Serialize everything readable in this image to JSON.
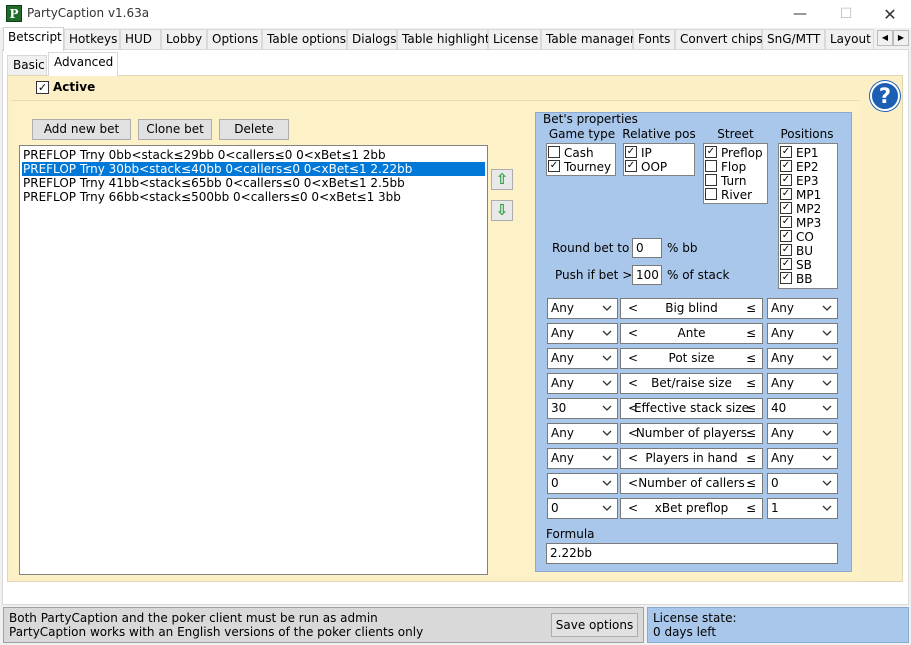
{
  "window": {
    "title": "PartyCaption v1.63a",
    "icon_letter": "P",
    "minimize_glyph": "—",
    "maximize_glyph": "☐",
    "close_glyph": "✕"
  },
  "tabs": [
    "Betscript",
    "Hotkeys",
    "HUD",
    "Lobby",
    "Options",
    "Table options",
    "Dialogs",
    "Table highlight",
    "License",
    "Table manager",
    "Fonts",
    "Convert chips",
    "SnG/MTT",
    "Layout"
  ],
  "tab_scroll": {
    "left": "◀",
    "right": "▶"
  },
  "subtabs": [
    "Basic",
    "Advanced"
  ],
  "active_label": "Active",
  "active_checked": "✓",
  "buttons": {
    "add": "Add new bet",
    "clone": "Clone bet",
    "delete": "Delete",
    "move_up": "⇧",
    "move_down": "⇩",
    "help": "?"
  },
  "bets": [
    "PREFLOP Trny 0bb<stack≤29bb 0<callers≤0 0<xBet≤1 2bb",
    "PREFLOP Trny 30bb<stack≤40bb 0<callers≤0 0<xBet≤1 2.22bb",
    "PREFLOP Trny 41bb<stack≤65bb 0<callers≤0 0<xBet≤1 2.5bb",
    "PREFLOP Trny 66bb<stack≤500bb 0<callers≤0 0<xBet≤1 3bb"
  ],
  "props": {
    "title": "Bet's properties",
    "game_type": {
      "title": "Game type",
      "items": [
        {
          "label": "Cash",
          "checked": ""
        },
        {
          "label": "Tourney",
          "checked": "✓"
        }
      ]
    },
    "relative_pos": {
      "title": "Relative pos",
      "items": [
        {
          "label": "IP",
          "checked": "✓"
        },
        {
          "label": "OOP",
          "checked": "✓"
        }
      ]
    },
    "street": {
      "title": "Street",
      "items": [
        {
          "label": "Preflop",
          "checked": "✓"
        },
        {
          "label": "Flop",
          "checked": ""
        },
        {
          "label": "Turn",
          "checked": ""
        },
        {
          "label": "River",
          "checked": ""
        }
      ]
    },
    "positions": {
      "title": "Positions",
      "items": [
        {
          "label": "EP1",
          "checked": "✓"
        },
        {
          "label": "EP2",
          "checked": "✓"
        },
        {
          "label": "EP3",
          "checked": "✓"
        },
        {
          "label": "MP1",
          "checked": "✓"
        },
        {
          "label": "MP2",
          "checked": "✓"
        },
        {
          "label": "MP3",
          "checked": "✓"
        },
        {
          "label": "CO",
          "checked": "✓"
        },
        {
          "label": "BU",
          "checked": "✓"
        },
        {
          "label": "SB",
          "checked": "✓"
        },
        {
          "label": "BB",
          "checked": "✓"
        }
      ]
    },
    "round_bet": {
      "label": "Round bet to",
      "value": "0",
      "unit": "% bb"
    },
    "push_if": {
      "label": "Push if bet >",
      "value": "100",
      "unit": "% of stack"
    },
    "lt_symbol": "<",
    "le_symbol": "≤",
    "conditions": [
      {
        "min": "Any",
        "name": "Big blind",
        "max": "Any"
      },
      {
        "min": "Any",
        "name": "Ante",
        "max": "Any"
      },
      {
        "min": "Any",
        "name": "Pot size",
        "max": "Any"
      },
      {
        "min": "Any",
        "name": "Bet/raise size",
        "max": "Any"
      },
      {
        "min": "30",
        "name": "Effective stack size",
        "max": "40"
      },
      {
        "min": "Any",
        "name": "Number of players",
        "max": "Any"
      },
      {
        "min": "Any",
        "name": "Players in hand",
        "max": "Any"
      },
      {
        "min": "0",
        "name": "Number of callers",
        "max": "0"
      },
      {
        "min": "0",
        "name": "xBet preflop",
        "max": "1"
      }
    ],
    "formula_label": "Formula",
    "formula_value": "2.22bb"
  },
  "status": {
    "line1": "Both PartyCaption and the poker client must be run as admin",
    "line2": "PartyCaption works with an English versions of the poker clients only",
    "save_button": "Save options",
    "license_label": "License state:",
    "license_value": "0 days left"
  }
}
